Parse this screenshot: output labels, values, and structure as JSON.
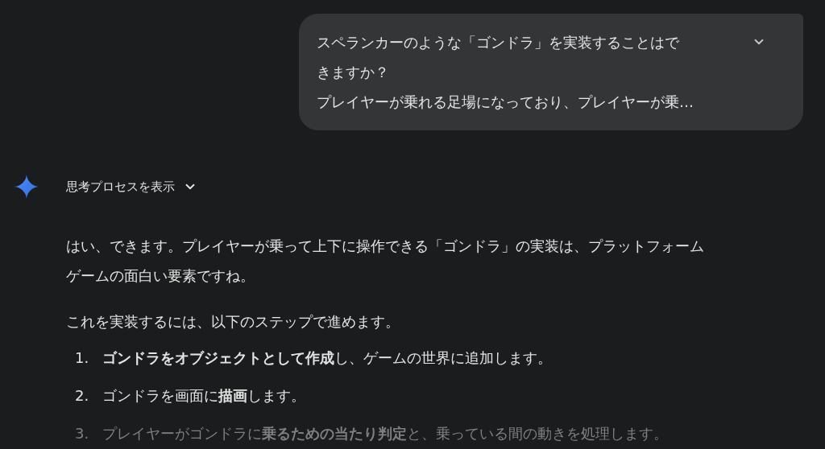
{
  "user_message": {
    "lines": [
      "スペランカーのような「ゴンドラ」を実装することはで",
      "きますか？",
      "プレイヤーが乗れる足場になっており、プレイヤーが乗…"
    ],
    "expanded": false
  },
  "thinking": {
    "label": "思考プロセスを表示",
    "expanded": false
  },
  "response": {
    "paragraphs": [
      {
        "lines": [
          "はい、できます。プレイヤーが乗って上下に操作できる「ゴンドラ」の実装は、プラットフォーム",
          "ゲームの面白い要素ですね。"
        ]
      },
      {
        "lines": [
          "これを実装するには、以下のステップで進めます。"
        ]
      }
    ],
    "steps": [
      {
        "number": "1.",
        "text": "**ゴンドラをオブジェクトとして作成**し、ゲームの世界に追加します。",
        "faded": false
      },
      {
        "number": "2.",
        "text": "ゴンドラを画面に**描画**します。",
        "faded": false
      },
      {
        "number": "3.",
        "text": "プレイヤーがゴンドラに**乗るための当たり判定**と、乗っている間の動きを処理します。",
        "faded": true
      }
    ]
  }
}
